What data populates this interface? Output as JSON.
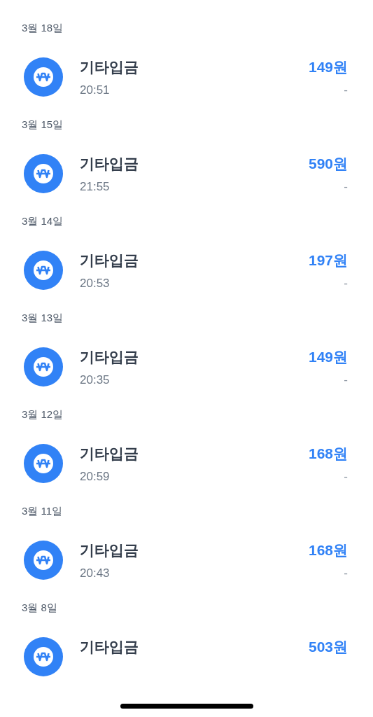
{
  "groups": [
    {
      "date": "3월 18일",
      "items": [
        {
          "title": "기타입금",
          "time": "20:51",
          "amount": "149원",
          "balance": "-"
        }
      ]
    },
    {
      "date": "3월 15일",
      "items": [
        {
          "title": "기타입금",
          "time": "21:55",
          "amount": "590원",
          "balance": "-"
        }
      ]
    },
    {
      "date": "3월 14일",
      "items": [
        {
          "title": "기타입금",
          "time": "20:53",
          "amount": "197원",
          "balance": "-"
        }
      ]
    },
    {
      "date": "3월 13일",
      "items": [
        {
          "title": "기타입금",
          "time": "20:35",
          "amount": "149원",
          "balance": "-"
        }
      ]
    },
    {
      "date": "3월 12일",
      "items": [
        {
          "title": "기타입금",
          "time": "20:59",
          "amount": "168원",
          "balance": "-"
        }
      ]
    },
    {
      "date": "3월 11일",
      "items": [
        {
          "title": "기타입금",
          "time": "20:43",
          "amount": "168원",
          "balance": "-"
        }
      ]
    },
    {
      "date": "3월 8일",
      "items": [
        {
          "title": "기타입금",
          "amount": "503원"
        }
      ]
    }
  ]
}
